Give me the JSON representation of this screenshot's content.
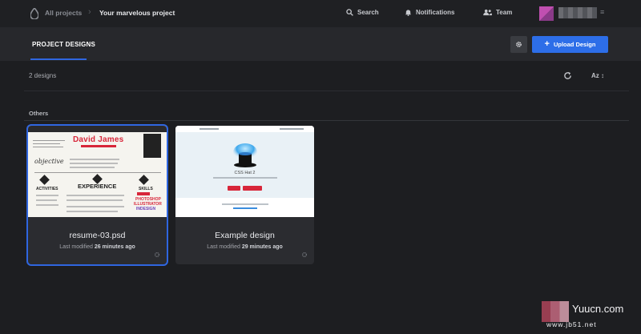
{
  "breadcrumb": {
    "all_projects": "All projects",
    "current_project": "Your marvelous project"
  },
  "nav": {
    "search": "Search",
    "notifications": "Notifications",
    "team": "Team"
  },
  "header": {
    "active_tab": "PROJECT DESIGNS",
    "upload_button": "Upload Design"
  },
  "toolbar": {
    "count": "2 designs",
    "sort_label": "Az"
  },
  "section": {
    "label": "Others"
  },
  "designs": [
    {
      "name": "resume-03.psd",
      "modified_prefix": "Last modified",
      "modified_time": "26 minutes ago",
      "selected": true
    },
    {
      "name": "Example design",
      "modified_prefix": "Last modified",
      "modified_time": "29 minutes ago",
      "selected": false
    }
  ],
  "resume_thumb": {
    "name": "David James",
    "objective": "objective",
    "experience": "EXPERIENCE",
    "activities": "ACTIVITIES",
    "skills": "SKILLS",
    "skill_words": [
      "PHOTOSHOP",
      "ILLUSTRATOR",
      "INDESIGN"
    ]
  },
  "example_thumb": {
    "title": "CSS Hat 2"
  },
  "watermark": {
    "brand": "Yuucn.com",
    "url": "www.jb51.net"
  },
  "colors": {
    "accent": "#2f66e0",
    "upload": "#2d6ee8",
    "background": "#1d1e21",
    "resume_red": "#d8263a"
  }
}
